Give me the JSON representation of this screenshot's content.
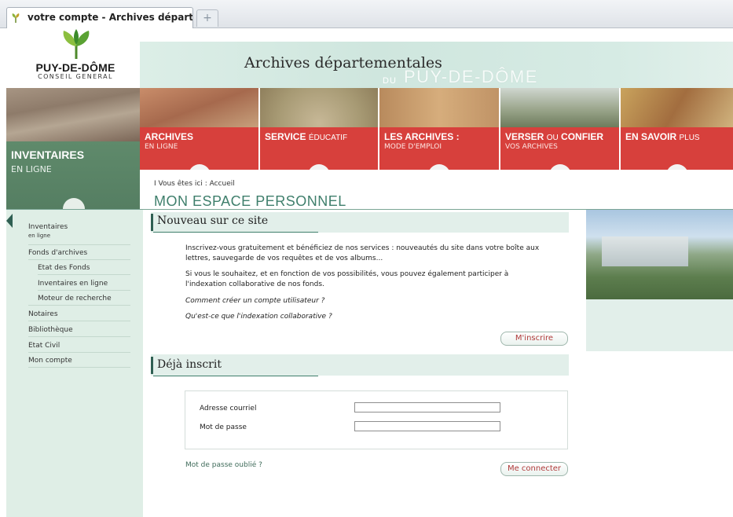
{
  "browser": {
    "tab_title": "votre compte - Archives départeme...",
    "new_tab_symbol": "+"
  },
  "logo": {
    "name": "PUY-DE-DÔME",
    "subtitle": "CONSEIL GENERAL"
  },
  "banner": {
    "title": "Archives départementales",
    "du": "DU",
    "region": "PUY-DE-DÔME"
  },
  "nav": {
    "home": {
      "title": "INVENTAIRES",
      "subtitle": "EN LIGNE"
    },
    "items": [
      {
        "label": "ARCHIVES",
        "light": "",
        "sub": "EN LIGNE"
      },
      {
        "label": "SERVICE",
        "light": "ÉDUCATIF",
        "sub": ""
      },
      {
        "label": "LES ARCHIVES :",
        "light": "",
        "sub": "MODE D'EMPLOI"
      },
      {
        "label": "VERSER",
        "light": "OU",
        "label2": "CONFIER",
        "sub": "VOS ARCHIVES"
      },
      {
        "label": "EN SAVOIR",
        "light": "PLUS",
        "sub": ""
      }
    ]
  },
  "breadcrumb": {
    "text": "I Vous êtes ici : Accueil"
  },
  "page_title": "MON ESPACE PERSONNEL",
  "sidebar": {
    "items": [
      {
        "label": "Inventaires"
      },
      {
        "label": "en ligne"
      },
      {
        "label": "Fonds d'archives"
      },
      {
        "label": "Etat des Fonds"
      },
      {
        "label": "Inventaires en ligne"
      },
      {
        "label": "Moteur de recherche"
      },
      {
        "label": "Notaires"
      },
      {
        "label": "Bibliothèque"
      },
      {
        "label": "Etat Civil"
      },
      {
        "label": "Mon compte"
      }
    ]
  },
  "new_section": {
    "title": "Nouveau sur ce site",
    "para1_line1": "Inscrivez-vous gratuitement et bénéficiez de nos services : nouveautés du site dans votre boîte aux",
    "para1_line2": "lettres, sauvegarde de vos requêtes et de vos albums...",
    "para2_line1": "Si vous le souhaitez, et en fonction de vos possibilités, vous pouvez également participer à",
    "para2_line2": "l'indexation collaborative de nos fonds.",
    "link1": "Comment créer un compte utilisateur ?",
    "link2": "Qu'est-ce que l'indexation collaborative ?",
    "register_button": "M'inscrire"
  },
  "login_section": {
    "title": "Déjà inscrit",
    "email_label": "Adresse courriel",
    "email_value": "",
    "password_label": "Mot de passe",
    "password_value": "",
    "forgot_link": "Mot de passe oublié ?",
    "connect_button": "Me connecter"
  },
  "colors": {
    "accent_green": "#3f7f6c",
    "nav_red": "#d7403c",
    "panel_green": "#dfeee6",
    "button_text": "#b03a3a"
  }
}
